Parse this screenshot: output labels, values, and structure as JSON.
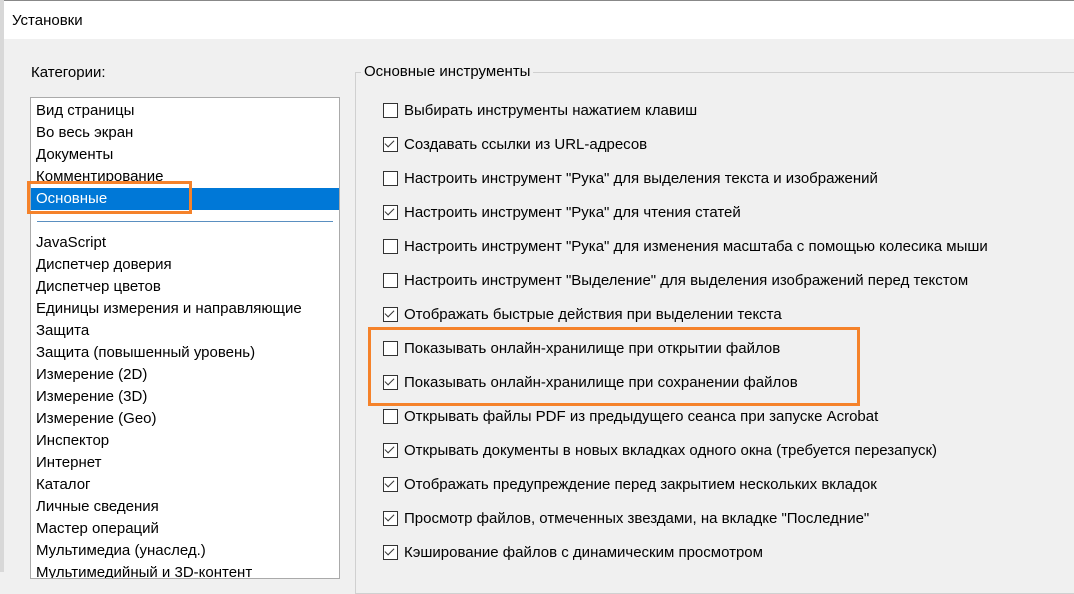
{
  "window": {
    "title": "Установки"
  },
  "categories": {
    "label": "Категории:",
    "top": [
      "Вид страницы",
      "Во весь экран",
      "Документы",
      "Комментирование",
      "Основные"
    ],
    "selected": "Основные",
    "rest": [
      "JavaScript",
      "Диспетчер доверия",
      "Диспетчер цветов",
      "Единицы измерения и направляющие",
      "Защита",
      "Защита (повышенный уровень)",
      "Измерение (2D)",
      "Измерение (3D)",
      "Измерение (Geo)",
      "Инспектор",
      "Интернет",
      "Каталог",
      "Личные сведения",
      "Мастер операций",
      "Мультимедиа (унаслед.)",
      "Мультимедийный и 3D-контент"
    ]
  },
  "group": {
    "label": "Основные инструменты",
    "options": [
      {
        "label": "Выбирать инструменты нажатием клавиш",
        "checked": false
      },
      {
        "label": "Создавать ссылки из URL-адресов",
        "checked": true
      },
      {
        "label": "Настроить инструмент \"Рука\" для выделения текста и изображений",
        "checked": false
      },
      {
        "label": "Настроить инструмент \"Рука\" для чтения статей",
        "checked": true
      },
      {
        "label": "Настроить инструмент \"Рука\" для изменения масштаба с помощью колесика мыши",
        "checked": false
      },
      {
        "label": "Настроить инструмент \"Выделение\" для выделения изображений перед текстом",
        "checked": false
      },
      {
        "label": "Отображать быстрые действия при выделении текста",
        "checked": true
      },
      {
        "label": "Показывать онлайн-хранилище при открытии файлов",
        "checked": false
      },
      {
        "label": "Показывать онлайн-хранилище при сохранении файлов",
        "checked": true
      },
      {
        "label": "Открывать файлы PDF из предыдущего сеанса при запуске Acrobat",
        "checked": false
      },
      {
        "label": "Открывать документы в новых вкладках одного окна (требуется перезапуск)",
        "checked": true
      },
      {
        "label": "Отображать предупреждение перед закрытием нескольких вкладок",
        "checked": true
      },
      {
        "label": "Просмотр файлов, отмеченных звездами, на вкладке \"Последние\"",
        "checked": true
      },
      {
        "label": "Кэширование файлов с динамическим просмотром",
        "checked": true
      }
    ]
  },
  "colors": {
    "highlight": "#f5822a",
    "selection": "#0078d7"
  }
}
